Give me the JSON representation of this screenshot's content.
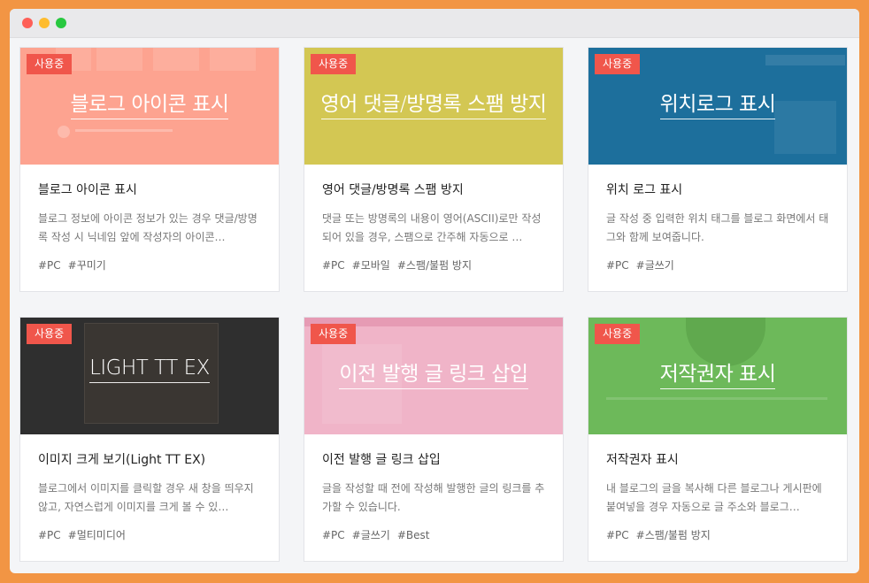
{
  "cards": [
    {
      "badge": "사용중",
      "thumb_title": "블로그 아이콘 표시",
      "title": "블로그 아이콘 표시",
      "desc": "블로그 정보에 아이콘 정보가 있는 경우 댓글/방명록 작성 시 닉네임 앞에 작성자의 아이콘…",
      "tags": [
        "#PC",
        "#꾸미기"
      ],
      "color": "#fda390"
    },
    {
      "badge": "사용중",
      "thumb_title": "영어 댓글/방명록 스팸 방지",
      "title": "영어 댓글/방명록 스팸 방지",
      "desc": "댓글 또는 방명록의 내용이 영어(ASCII)로만 작성되어 있을 경우, 스팸으로 간주해 자동으로 …",
      "tags": [
        "#PC",
        "#모바일",
        "#스팸/불펌 방지"
      ],
      "color": "#d3c753"
    },
    {
      "badge": "사용중",
      "thumb_title": "위치로그 표시",
      "title": "위치 로그 표시",
      "desc": "글 작성 중 입력한 위치 태그를 블로그 화면에서 태그와 함께 보여줍니다.",
      "tags": [
        "#PC",
        "#글쓰기"
      ],
      "color": "#1d6f9c"
    },
    {
      "badge": "사용중",
      "thumb_title": "LIGHT TT EX",
      "title": "이미지 크게 보기(Light TT EX)",
      "desc": "블로그에서 이미지를 클릭할 경우 새 창을 띄우지 않고, 자연스럽게 이미지를 크게 볼 수 있…",
      "tags": [
        "#PC",
        "#멀티미디어"
      ],
      "color": "#2f2f2f"
    },
    {
      "badge": "사용중",
      "thumb_title": "이전 발행 글 링크 삽입",
      "title": "이전 발행 글 링크 삽입",
      "desc": "글을 작성할 때 전에 작성해 발행한 글의 링크를 추가할 수 있습니다.",
      "tags": [
        "#PC",
        "#글쓰기",
        "#Best"
      ],
      "color": "#f0b4c8"
    },
    {
      "badge": "사용중",
      "thumb_title": "저작권자 표시",
      "title": "저작권자 표시",
      "desc": "내 블로그의 글을 복사해 다른 블로그나 게시판에 붙여넣을 경우 자동으로 글 주소와 블로그…",
      "tags": [
        "#PC",
        "#스팸/불펌 방지"
      ],
      "color": "#6db95a"
    }
  ]
}
